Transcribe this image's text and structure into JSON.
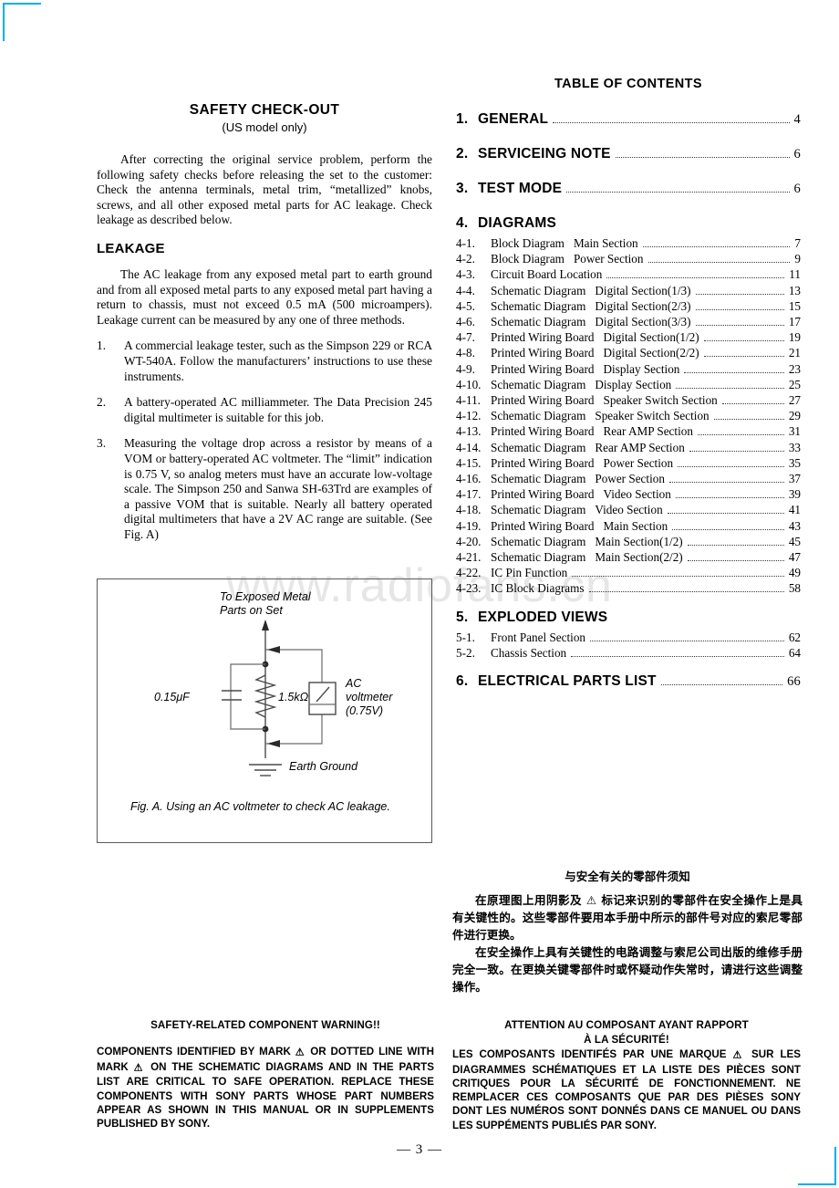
{
  "watermark": "www.radiofans.cn",
  "page_footer": "— 3 —",
  "left": {
    "title": "SAFETY  CHECK-OUT",
    "subtitle": "(US model only)",
    "intro": "After correcting the original service problem, perform the following safety checks before releasing the set to the customer: Check the antenna terminals, metal trim, “metallized” knobs, screws, and all other exposed metal parts for AC leakage. Check leakage as described below.",
    "leakage_heading": "LEAKAGE",
    "leakage_p": "The AC leakage from any exposed metal part to earth ground and from all exposed metal parts to any exposed metal part having a return to chassis, must not exceed 0.5 mA (500 microampers). Leakage current can be measured by any one of three methods.",
    "methods": [
      {
        "num": "1.",
        "text": "A commercial leakage tester, such as the Simpson 229 or RCA WT-540A. Follow the manufacturers’ instructions to use these instruments."
      },
      {
        "num": "2.",
        "text": "A battery-operated AC milliammeter. The Data Precision 245 digital multimeter is suitable for this job."
      },
      {
        "num": "3.",
        "text": "Measuring the voltage drop across a resistor by means of a VOM or battery-operated AC voltmeter. The “limit” indication is 0.75 V, so analog meters must have an accurate low-voltage scale. The Simpson 250 and Sanwa SH-63Trd are examples of a passive VOM that is suitable. Nearly all battery operated digital multimeters that have a 2V AC range are suitable. (See Fig. A)"
      }
    ]
  },
  "figure": {
    "top_label_line1": "To Exposed Metal",
    "top_label_line2": "Parts on Set",
    "capacitor_label": "0.15μF",
    "resistor_label": "1.5kΩ",
    "meter_line1": "AC",
    "meter_line2": "voltmeter",
    "meter_line3": "(0.75V)",
    "ground_label": "Earth Ground",
    "caption": "Fig. A.  Using an AC voltmeter to check AC leakage."
  },
  "toc": {
    "title": "TABLE OF CONTENTS",
    "majors": [
      {
        "num": "1.",
        "label": "GENERAL",
        "page": "4",
        "dots": true
      },
      {
        "num": "2.",
        "label": "SERVICEING NOTE",
        "page": "6",
        "dots": true
      },
      {
        "num": "3.",
        "label": "TEST MODE",
        "page": "6",
        "dots": true
      },
      {
        "num": "4.",
        "label": "DIAGRAMS",
        "page": "",
        "dots": false
      },
      {
        "num": "5.",
        "label": "EXPLODED VIEWS",
        "page": "",
        "dots": false
      },
      {
        "num": "6.",
        "label": "ELECTRICAL PARTS LIST",
        "page": "66",
        "dots": true
      }
    ],
    "diagrams": [
      {
        "num": "4-1.",
        "label": "Block Diagram",
        "sub": "Main Section",
        "page": "7"
      },
      {
        "num": "4-2.",
        "label": "Block Diagram",
        "sub": "Power Section",
        "page": "9"
      },
      {
        "num": "4-3.",
        "label": "Circuit Board Location",
        "sub": "",
        "page": "11"
      },
      {
        "num": "4-4.",
        "label": "Schematic Diagram",
        "sub": "Digital Section(1/3)",
        "page": "13"
      },
      {
        "num": "4-5.",
        "label": "Schematic Diagram",
        "sub": "Digital Section(2/3)",
        "page": "15"
      },
      {
        "num": "4-6.",
        "label": "Schematic Diagram",
        "sub": "Digital Section(3/3)",
        "page": "17"
      },
      {
        "num": "4-7.",
        "label": "Printed Wiring Board",
        "sub": "Digital Section(1/2)",
        "page": "19"
      },
      {
        "num": "4-8.",
        "label": "Printed Wiring Board",
        "sub": "Digital Section(2/2)",
        "page": "21"
      },
      {
        "num": "4-9.",
        "label": "Printed Wiring Board",
        "sub": "Display Section",
        "page": "23"
      },
      {
        "num": "4-10.",
        "label": "Schematic Diagram",
        "sub": "Display Section",
        "page": "25"
      },
      {
        "num": "4-11.",
        "label": "Printed Wiring Board",
        "sub": "Speaker Switch Section",
        "page": "27"
      },
      {
        "num": "4-12.",
        "label": "Schematic Diagram",
        "sub": "Speaker Switch Section",
        "page": "29"
      },
      {
        "num": "4-13.",
        "label": "Printed Wiring Board",
        "sub": "Rear AMP Section",
        "page": "31"
      },
      {
        "num": "4-14.",
        "label": "Schematic Diagram",
        "sub": "Rear AMP Section",
        "page": "33"
      },
      {
        "num": "4-15.",
        "label": "Printed Wiring Board",
        "sub": "Power Section",
        "page": "35"
      },
      {
        "num": "4-16.",
        "label": "Schematic Diagram",
        "sub": "Power Section",
        "page": "37"
      },
      {
        "num": "4-17.",
        "label": "Printed Wiring Board",
        "sub": "Video Section",
        "page": "39"
      },
      {
        "num": "4-18.",
        "label": "Schematic Diagram",
        "sub": "Video Section",
        "page": "41"
      },
      {
        "num": "4-19.",
        "label": "Printed Wiring Board",
        "sub": "Main Section",
        "page": "43"
      },
      {
        "num": "4-20.",
        "label": "Schematic Diagram",
        "sub": "Main Section(1/2)",
        "page": "45"
      },
      {
        "num": "4-21.",
        "label": "Schematic Diagram",
        "sub": "Main Section(2/2)",
        "page": "47"
      },
      {
        "num": "4-22.",
        "label": "IC Pin Function",
        "sub": "",
        "page": "49"
      },
      {
        "num": "4-23.",
        "label": "IC Block Diagrams",
        "sub": "",
        "page": "58"
      }
    ],
    "exploded": [
      {
        "num": "5-1.",
        "label": "Front Panel Section",
        "sub": "",
        "page": "62"
      },
      {
        "num": "5-2.",
        "label": "Chassis Section",
        "sub": "",
        "page": "64"
      }
    ]
  },
  "cn_note": {
    "title": "与安全有关的零部件须知",
    "p1": "在原理图上用阴影及 ⚠ 标记来识别的零部件在安全操作上是具有关键性的。这些零部件要用本手册中所示的部件号对应的索尼零部件进行更换。",
    "p2": "在安全操作上具有关键性的电路调整与索尼公司出版的维修手册完全一致。在更换关键零部件时或怀疑动作失常时，请进行这些调整操作。"
  },
  "warn_en": {
    "heading": "SAFETY-RELATED COMPONENT WARNING!!",
    "body_a": "COMPONENTS IDENTIFIED BY MARK ",
    "body_b": " OR DOTTED LINE WITH MARK ",
    "body_c": " ON THE SCHEMATIC DIAGRAMS AND IN THE PARTS LIST ARE CRITICAL TO SAFE OPERATION. REPLACE THESE COMPONENTS WITH SONY PARTS WHOSE PART NUMBERS APPEAR AS SHOWN IN THIS MANUAL OR IN SUPPLEMENTS PUBLISHED BY SONY."
  },
  "warn_fr": {
    "heading_line1": "ATTENTION AU COMPOSANT AYANT RAPPORT",
    "heading_line2": "À LA SÉCURITÉ!",
    "body_a": "LES COMPOSANTS IDENTIFÉS PAR UNE MARQUE ",
    "body_b": " SUR LES DIAGRAMMES SCHÉMATIQUES ET LA LISTE DES PIÈCES SONT CRITIQUES POUR LA SÉCURITÉ DE FONCTIONNEMENT. NE REMPLACER CES COMPOSANTS QUE PAR DES PIÈSES SONY DONT LES NUMÉROS SONT DONNÉS DANS CE MANUEL OU DANS LES SUPPÉMENTS PUBLIÉS PAR SONY."
  },
  "colors": {
    "crop_mark": "#00AEEF",
    "watermark": "#e6e6e6",
    "figure_border": "#5a5a5a"
  }
}
